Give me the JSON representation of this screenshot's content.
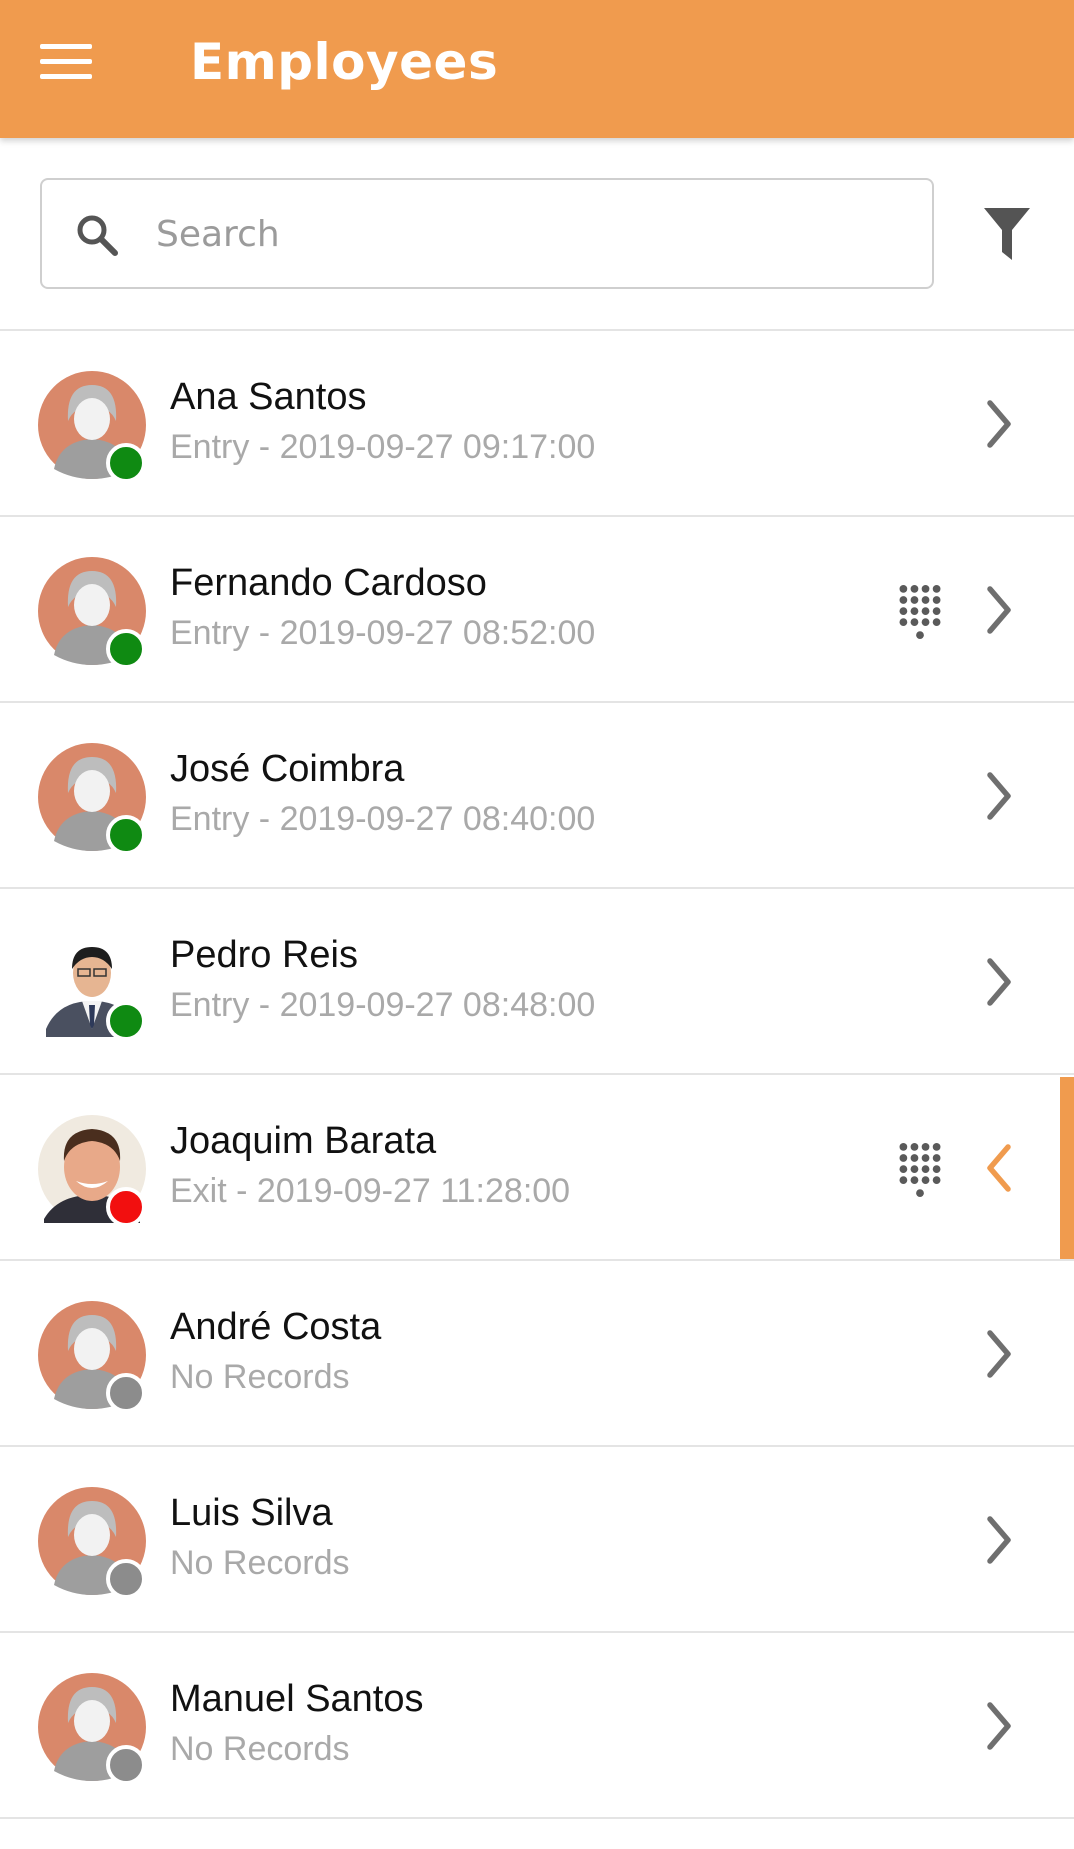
{
  "header": {
    "title": "Employees",
    "menu_icon": "hamburger-menu-icon",
    "background_color": "#F09B4E"
  },
  "search": {
    "placeholder": "Search",
    "value": "",
    "icon": "search-icon"
  },
  "filter": {
    "icon": "filter-funnel-icon"
  },
  "status_colors": {
    "in": "#0F8A12",
    "out": "#F20F0F",
    "none": "#8C8C8C"
  },
  "employees": [
    {
      "name": "Ana Santos",
      "status": "Entry - 2019-09-27 09:17:00",
      "presence": "in",
      "avatar": "default-avatar",
      "keypad": false,
      "selected": false
    },
    {
      "name": "Fernando Cardoso",
      "status": "Entry - 2019-09-27 08:52:00",
      "presence": "in",
      "avatar": "default-avatar",
      "keypad": true,
      "selected": false
    },
    {
      "name": "José Coimbra",
      "status": "Entry - 2019-09-27 08:40:00",
      "presence": "in",
      "avatar": "default-avatar",
      "keypad": false,
      "selected": false
    },
    {
      "name": "Pedro Reis",
      "status": "Entry - 2019-09-27 08:48:00",
      "presence": "in",
      "avatar": "photo-man-suit",
      "keypad": false,
      "selected": false
    },
    {
      "name": "Joaquim Barata",
      "status": "Exit - 2019-09-27 11:28:00",
      "presence": "out",
      "avatar": "photo-man-smiling",
      "keypad": true,
      "selected": true
    },
    {
      "name": "André Costa",
      "status": "No Records",
      "presence": "none",
      "avatar": "default-avatar",
      "keypad": false,
      "selected": false
    },
    {
      "name": "Luis Silva",
      "status": "No Records",
      "presence": "none",
      "avatar": "default-avatar",
      "keypad": false,
      "selected": false
    },
    {
      "name": "Manuel Santos",
      "status": "No Records",
      "presence": "none",
      "avatar": "default-avatar",
      "keypad": false,
      "selected": false
    }
  ]
}
